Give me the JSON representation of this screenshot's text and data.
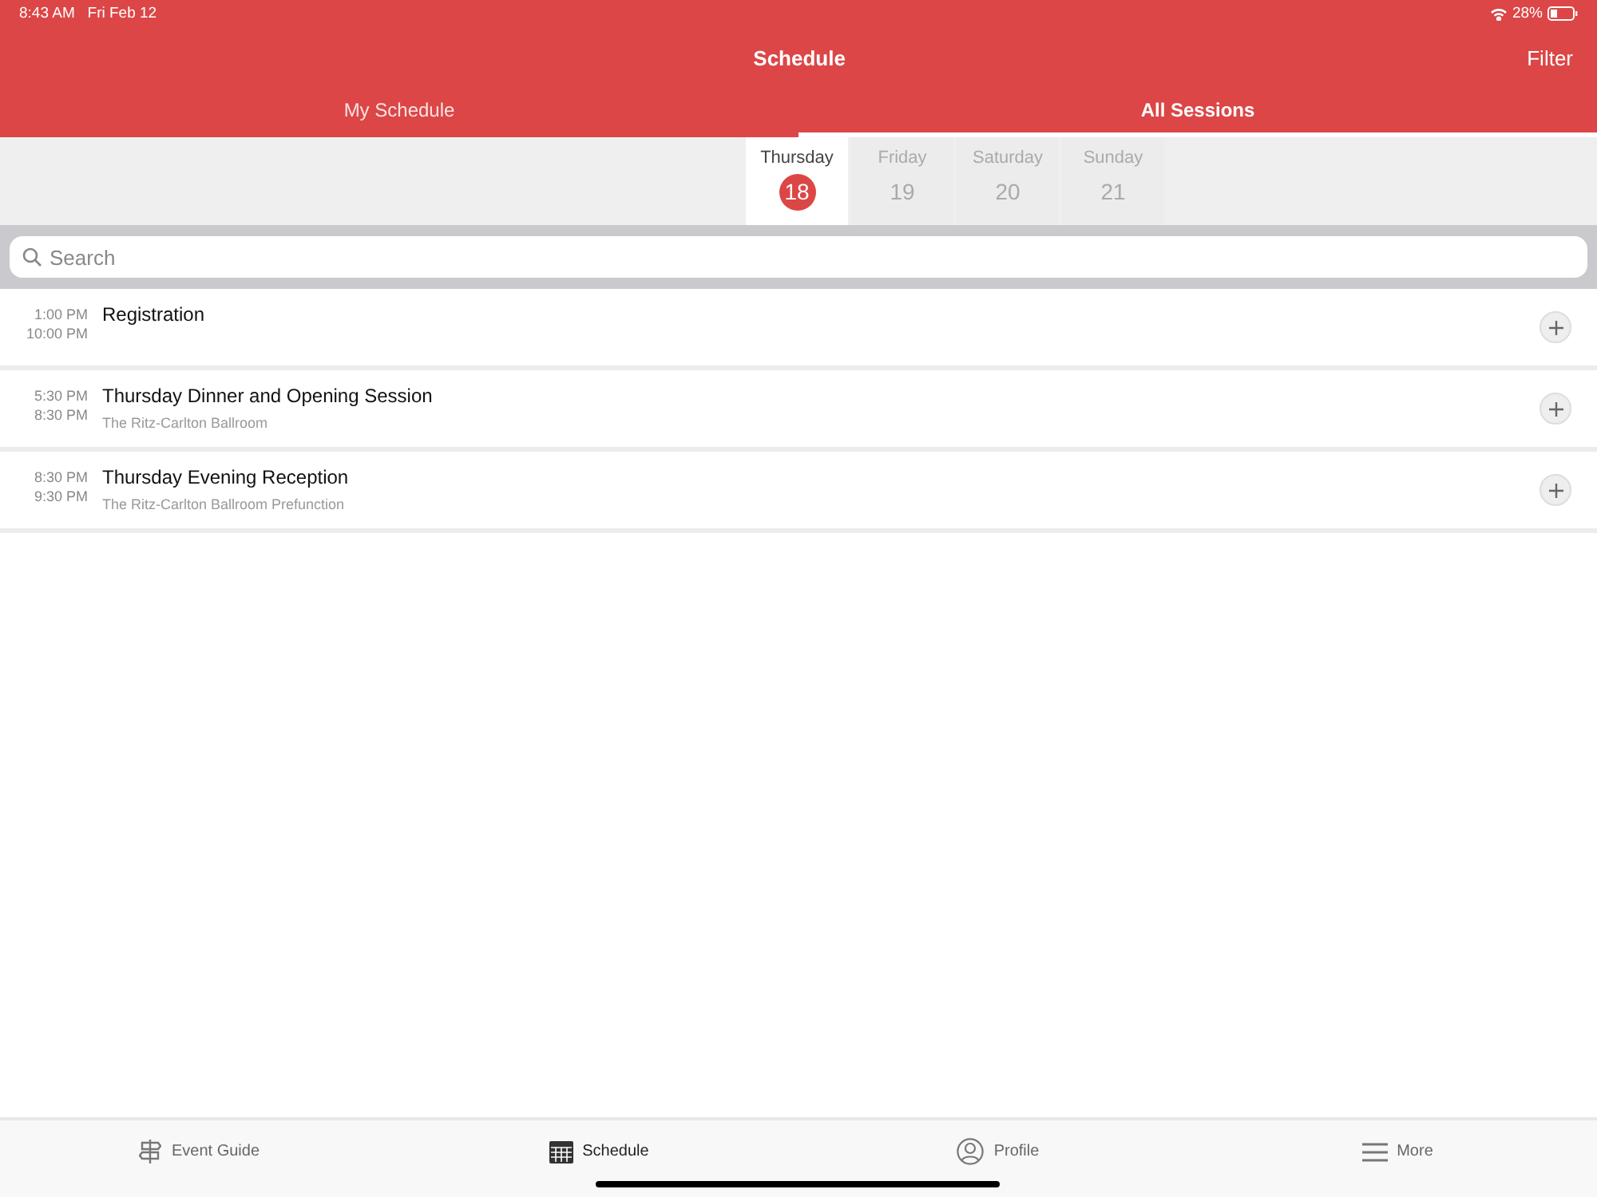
{
  "status_bar": {
    "time": "8:43 AM",
    "date": "Fri Feb 12",
    "battery": "28%"
  },
  "header": {
    "title": "Schedule",
    "action": "Filter"
  },
  "tabs": [
    {
      "label": "My Schedule",
      "selected": false
    },
    {
      "label": "All Sessions",
      "selected": true
    }
  ],
  "days": [
    {
      "weekday": "Thursday",
      "date": "18",
      "selected": true
    },
    {
      "weekday": "Friday",
      "date": "19",
      "selected": false
    },
    {
      "weekday": "Saturday",
      "date": "20",
      "selected": false
    },
    {
      "weekday": "Sunday",
      "date": "21",
      "selected": false
    }
  ],
  "search": {
    "placeholder": "Search"
  },
  "sessions": [
    {
      "start": "1:00 PM",
      "end": "10:00 PM",
      "title": "Registration"
    },
    {
      "start": "5:30 PM",
      "end": "8:30 PM",
      "title": "Thursday Dinner and Opening Session",
      "location": "The Ritz-Carlton Ballroom"
    },
    {
      "start": "8:30 PM",
      "end": "9:30 PM",
      "title": "Thursday Evening Reception",
      "location": "The Ritz-Carlton Ballroom Prefunction"
    }
  ],
  "tab_bar": [
    {
      "kind": "signpost",
      "label": "Event Guide",
      "selected": false
    },
    {
      "kind": "calendar",
      "label": "Schedule",
      "selected": true
    },
    {
      "kind": "person",
      "label": "Profile",
      "selected": false
    },
    {
      "kind": "menu",
      "label": "More",
      "selected": false
    }
  ]
}
